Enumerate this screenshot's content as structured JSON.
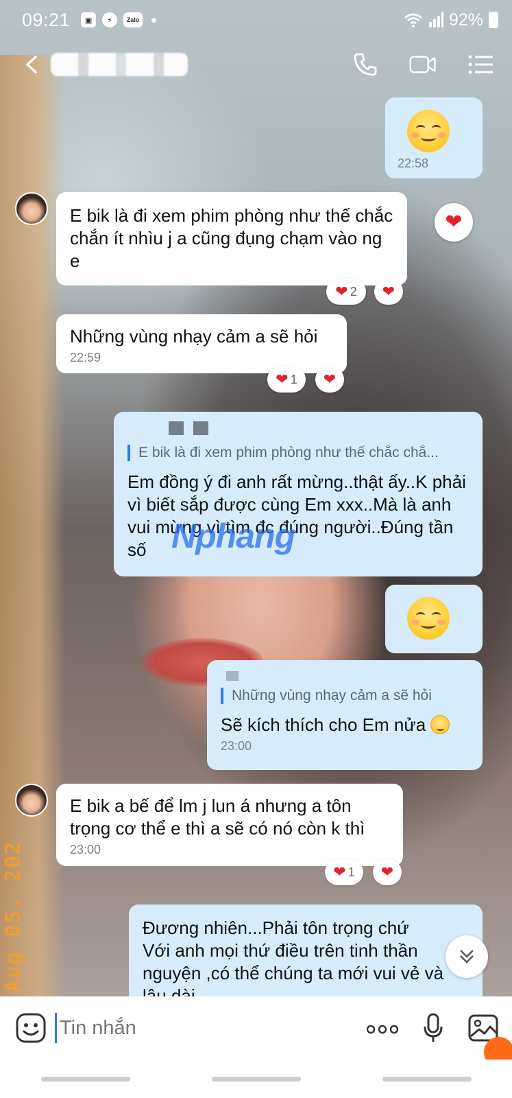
{
  "status_bar": {
    "time": "09:21",
    "apps": [
      "gallery",
      "messenger",
      "Zalo"
    ],
    "battery": "92%"
  },
  "header": {
    "contact_name": "",
    "actions": [
      "phone-icon",
      "video-call-icon",
      "menu-icon"
    ]
  },
  "messages": [
    {
      "side": "out",
      "type": "emoji",
      "emoji": "smiling-face-icon",
      "time": "22:58"
    },
    {
      "side": "in",
      "text": "E bik là đi xem phim phòng như thế chắc chắn ít nhìu j a cũng đụng chạm vào ng e",
      "reaction_count": "2"
    },
    {
      "side": "in",
      "text": "Những vùng nhạy cảm a sẽ hỏi",
      "time": "22:59",
      "reaction_count": "1"
    },
    {
      "side": "out",
      "quote": "E bik là đi xem phim phòng như thế chắc chắ...",
      "text": "Em đồng ý đi anh rất mừng..thật ấy..K phải vì biết sắp được cùng Em xxx..Mà là anh vui mừng vì tìm đc đúng người..Đúng tần số"
    },
    {
      "side": "out",
      "type": "emoji",
      "emoji": "smiling-face-icon"
    },
    {
      "side": "out",
      "quote": "Những vùng nhạy cảm a sẽ hỏi",
      "text": "Sẽ kích thích cho Em nửa",
      "time": "23:00"
    },
    {
      "side": "in",
      "text": "E bik a bế để lm j lun á nhưng a tôn trọng cơ thể e thì a sẽ có nó còn k thì",
      "time": "23:00",
      "reaction_count": "1"
    },
    {
      "side": "out",
      "text": "Đương nhiên...Phải tôn trọng chứ\nVới anh mọi thứ điều trên tinh thần\nnguyện ,có thể chúng ta mới vui vẻ và\nlâu dài"
    }
  ],
  "watermark": "Nphang",
  "photo_stamp": "Aug 05. 202",
  "composer": {
    "placeholder": "Tin nhắn"
  },
  "colors": {
    "outgoing_bubble": "#d6ecfb",
    "incoming_bubble": "#ffffff",
    "accent": "#2f7de1",
    "heart": "#e0242c"
  }
}
